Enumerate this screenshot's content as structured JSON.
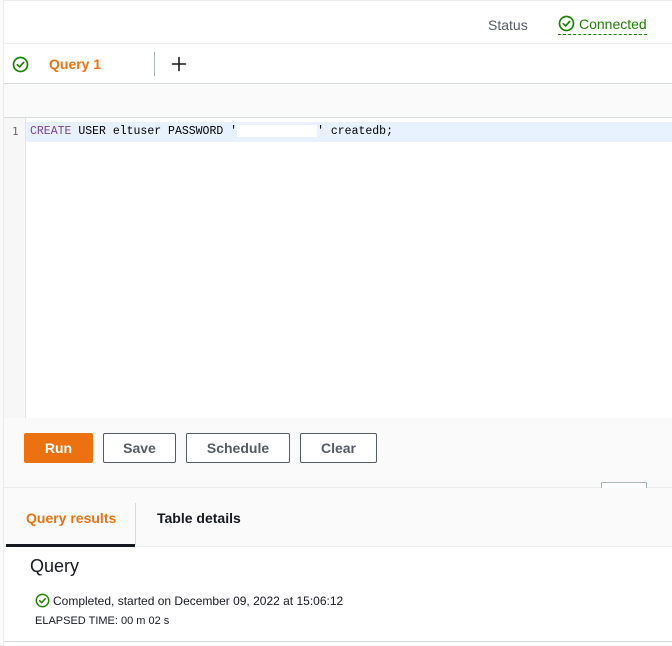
{
  "status_bar": {
    "label": "Status",
    "value": "Connected",
    "color": "#1d8102"
  },
  "tabs": {
    "items": [
      {
        "label": "Query 1",
        "state": "connected"
      }
    ],
    "add_icon": "plus-icon"
  },
  "editor": {
    "line_number": "1",
    "keyword": "CREATE",
    "code_before_redaction": " USER eltuser PASSWORD '",
    "code_after_redaction": "' createdb;"
  },
  "actions": {
    "run": "Run",
    "save": "Save",
    "schedule": "Schedule",
    "clear": "Clear",
    "accent": "#ec7211"
  },
  "results": {
    "tabs": [
      {
        "label": "Query results"
      },
      {
        "label": "Table details"
      }
    ],
    "title": "Query",
    "status_text": "Completed, started on December 09, 2022 at 15:06:12",
    "elapsed": "ELAPSED TIME: 00 m 02 s"
  }
}
